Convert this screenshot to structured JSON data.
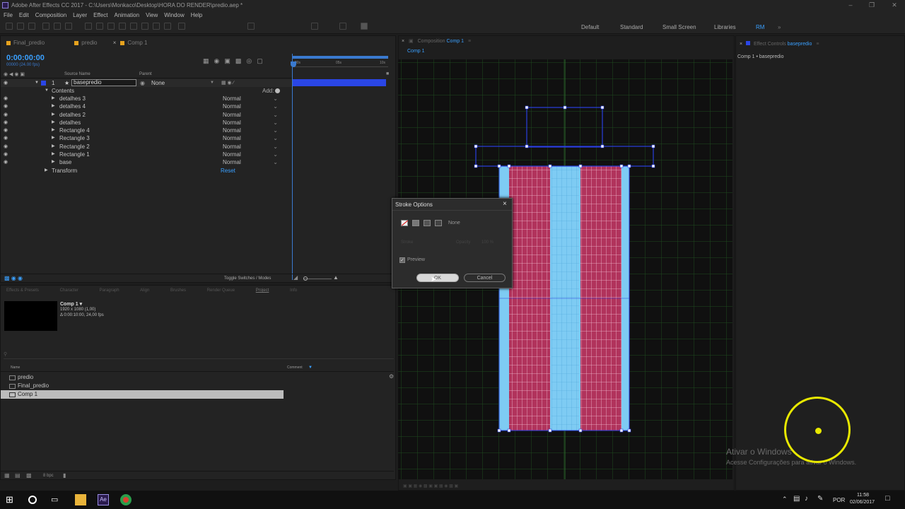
{
  "window": {
    "title": "Adobe After Effects CC 2017 - C:\\Users\\Monkaco\\Desktop\\HORA DO RENDER\\predio.aep *"
  },
  "menu": [
    "File",
    "Edit",
    "Composition",
    "Layer",
    "Effect",
    "Animation",
    "View",
    "Window",
    "Help"
  ],
  "workspaces": {
    "default": "Default",
    "standard": "Standard",
    "small_screen": "Small Screen",
    "libraries": "Libraries",
    "rm": "RM"
  },
  "timeline": {
    "tabs": [
      "Final_predio",
      "predio",
      "Comp 1"
    ],
    "timecode": "0:00:00:00",
    "timecode_sub": "00000 (24.00 fps)",
    "col_source": "Source Name",
    "col_parent": "Parent",
    "ruler": [
      "00s",
      "05s",
      "10s"
    ],
    "layer": {
      "num": "1",
      "name": "basepredio",
      "parent": "None"
    },
    "contents_label": "Contents",
    "add_label": "Add:",
    "items": [
      {
        "name": "detalhes 3",
        "mode": "Normal"
      },
      {
        "name": "detalhes 4",
        "mode": "Normal"
      },
      {
        "name": "detalhes 2",
        "mode": "Normal"
      },
      {
        "name": "detalhes",
        "mode": "Normal"
      },
      {
        "name": "Rectangle 4",
        "mode": "Normal"
      },
      {
        "name": "Rectangle 3",
        "mode": "Normal"
      },
      {
        "name": "Rectangle 2",
        "mode": "Normal"
      },
      {
        "name": "Rectangle 1",
        "mode": "Normal"
      },
      {
        "name": "base",
        "mode": "Normal"
      }
    ],
    "transform_label": "Transform",
    "reset_label": "Reset",
    "toggle_label": "Toggle Switches / Modes"
  },
  "bottom_tabs": [
    "Effects & Presets",
    "Character",
    "Paragraph",
    "Align",
    "Brushes",
    "Render Queue",
    "Project",
    "Info"
  ],
  "project": {
    "comp_name": "Comp 1 ▾",
    "comp_res": "1920 x 1080 (1,00)",
    "comp_dur": "Δ 0:00:10:00, 24,00 fps",
    "col_name": "Name",
    "col_comment": "Comment",
    "items": [
      "predio",
      "Final_predio",
      "Comp 1"
    ],
    "bpc": "8 bpc"
  },
  "composition": {
    "tab": "Composition",
    "tab_name": "Comp 1",
    "breadcrumb": "Comp 1"
  },
  "effect_controls": {
    "tab": "Effect Controls",
    "layer_name": "basepredio",
    "breadcrumb": "Comp 1 • basepredio"
  },
  "dialog": {
    "title": "Stroke Options",
    "none_label": "None",
    "stroke_label": "Stroke",
    "opacity_label": "Opacity",
    "opacity_value": "100 %",
    "preview_label": "Preview",
    "ok_label": "OK",
    "cancel_label": "Cancel"
  },
  "watermark": {
    "line1": "Ativar o Windows",
    "line2": "Acesse Configurações para ativar o Windows."
  },
  "taskbar": {
    "lang": "POR",
    "time": "11:58",
    "date": "02/06/2017"
  },
  "colors": {
    "accent_blue": "#3aa0ff",
    "building_red": "#b1335c",
    "building_cyan": "#7ecbf3",
    "grid_green": "#1e4a1e",
    "selection_blue": "#2a3fe0"
  }
}
